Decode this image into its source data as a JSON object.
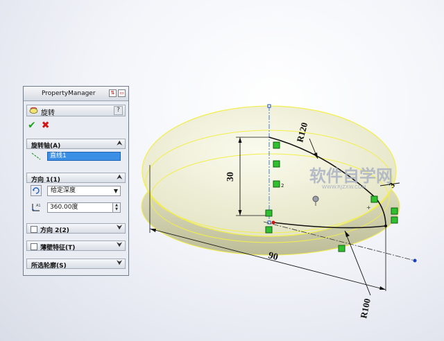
{
  "property_manager": {
    "title": "PropertyManager",
    "feature": {
      "label": "旋转",
      "help": "?"
    },
    "ok_symbol": "✔",
    "cancel_symbol": "✖",
    "axis_section": {
      "label": "旋转轴(A)",
      "chevron": "⮝",
      "value": "直线1"
    },
    "direction1_section": {
      "label": "方向 1(1)",
      "chevron": "⮝",
      "end_condition": "给定深度",
      "angle": "360.00度"
    },
    "direction2_section": {
      "label": "方向 2(2)",
      "chevron": "⮟"
    },
    "thin_section": {
      "label": "薄壁特征(T)",
      "chevron": "⮟"
    },
    "contours_section": {
      "label": "所选轮廓(S)",
      "chevron": "⮟"
    }
  },
  "sketch": {
    "dims": {
      "height": "30",
      "width": "90",
      "radius_top": "R120",
      "radius_bottom": "R100",
      "small": "3"
    },
    "relation_label": "2"
  },
  "watermark": {
    "text": "软件自学网",
    "url": "WWW.RJZXW.COM"
  },
  "colors": {
    "model_fill": "#efefd9",
    "model_edge": "#f2ef4a",
    "relation_green": "#2fbf2f",
    "dimension": "#111111",
    "axis_field_bg": "#3b8fe4"
  }
}
